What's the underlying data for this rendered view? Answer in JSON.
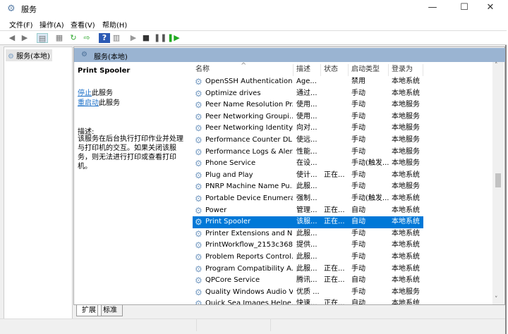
{
  "window": {
    "title": "服务",
    "icon": "gear-icon"
  },
  "menu": [
    "文件(F)",
    "操作(A)",
    "查看(V)",
    "帮助(H)"
  ],
  "toolbar": [
    "back-icon",
    "forward-icon",
    "show-console-tree-icon",
    "properties-icon",
    "refresh-icon",
    "export-list-icon",
    "help-icon",
    "view-icon",
    "start-icon",
    "stop-icon",
    "pause-icon",
    "restart-icon"
  ],
  "tree": {
    "item": "服务(本地)"
  },
  "header": {
    "title": "服务(本地)"
  },
  "detail": {
    "service_name": "Print Spooler",
    "stop_link": "停止",
    "stop_suffix": "此服务",
    "restart_link": "重启动",
    "restart_suffix": "此服务",
    "desc_label": "描述:",
    "description": "该服务在后台执行打印作业并处理与打印机的交互。如果关闭该服务，则无法进行打印或查看打印机。"
  },
  "columns": [
    "名称",
    "描述",
    "状态",
    "启动类型",
    "登录为"
  ],
  "rows": [
    [
      "OpenSSH Authentication ...",
      "Age...",
      "",
      "禁用",
      "本地系统"
    ],
    [
      "Optimize drives",
      "通过...",
      "",
      "手动",
      "本地系统"
    ],
    [
      "Peer Name Resolution Pr...",
      "使用...",
      "",
      "手动",
      "本地服务"
    ],
    [
      "Peer Networking Groupi...",
      "使用...",
      "",
      "手动",
      "本地服务"
    ],
    [
      "Peer Networking Identity...",
      "向对...",
      "",
      "手动",
      "本地服务"
    ],
    [
      "Performance Counter DL...",
      "使远...",
      "",
      "手动",
      "本地服务"
    ],
    [
      "Performance Logs & Aler...",
      "性能...",
      "",
      "手动",
      "本地服务"
    ],
    [
      "Phone Service",
      "在设...",
      "",
      "手动(触发...",
      "本地服务"
    ],
    [
      "Plug and Play",
      "使计...",
      "正在...",
      "手动",
      "本地系统"
    ],
    [
      "PNRP Machine Name Pu...",
      "此服...",
      "",
      "手动",
      "本地服务"
    ],
    [
      "Portable Device Enumera...",
      "强制...",
      "",
      "手动(触发...",
      "本地系统"
    ],
    [
      "Power",
      "管理...",
      "正在...",
      "自动",
      "本地系统"
    ],
    [
      "Print Spooler",
      "该服...",
      "正在...",
      "自动",
      "本地系统"
    ],
    [
      "Printer Extensions and N...",
      "此服...",
      "",
      "手动",
      "本地系统"
    ],
    [
      "PrintWorkflow_2153c368",
      "提供...",
      "",
      "手动",
      "本地系统"
    ],
    [
      "Problem Reports Control...",
      "此服...",
      "",
      "手动",
      "本地系统"
    ],
    [
      "Program Compatibility A...",
      "此服...",
      "正在...",
      "手动",
      "本地系统"
    ],
    [
      "QPCore Service",
      "腾讯...",
      "正在...",
      "自动",
      "本地系统"
    ],
    [
      "Quality Windows Audio V...",
      "优质 ...",
      "",
      "手动",
      "本地服务"
    ],
    [
      "Quick Sea Images Helpe...",
      "快速...",
      "正在...",
      "自动",
      "本地系统"
    ]
  ],
  "selected_row": 12,
  "tabs": [
    "扩展",
    "标准"
  ],
  "colors": {
    "header_band": "#9ab4d2",
    "selection": "#0078d7",
    "link": "#1a6fc8"
  }
}
